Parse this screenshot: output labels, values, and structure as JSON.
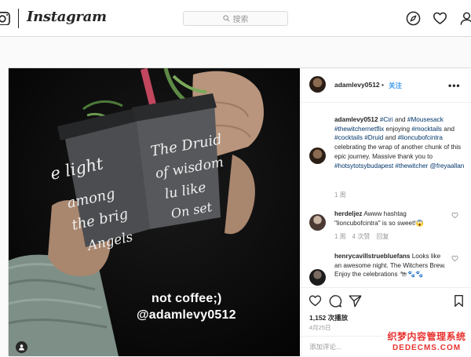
{
  "app": {
    "wordmark": "Instagram"
  },
  "search": {
    "placeholder": "搜索"
  },
  "media": {
    "overlay_line1": "not coffee;)",
    "overlay_line2": "@adamlevy0512",
    "cup_left_text": [
      "e light",
      "among",
      "the brig",
      "Angels"
    ],
    "cup_right_text": [
      "The Druid",
      "of wisdom",
      "lu like",
      "On set"
    ]
  },
  "post": {
    "username": "adamlevy0512",
    "dot": "•",
    "follow_label": "关注",
    "more_label": "•••",
    "caption_user": "adamlevy0512",
    "caption_parts": [
      {
        "t": " ",
        "tag": false
      },
      {
        "t": "#Ciri",
        "tag": true
      },
      {
        "t": " and ",
        "tag": false
      },
      {
        "t": "#Mousesack",
        "tag": true
      },
      {
        "t": " ",
        "tag": false
      },
      {
        "t": "#thewitchernetflix",
        "tag": true
      },
      {
        "t": " enjoying ",
        "tag": false
      },
      {
        "t": "#mocktails",
        "tag": true
      },
      {
        "t": " and ",
        "tag": false
      },
      {
        "t": "#cocktails",
        "tag": true
      },
      {
        "t": " ",
        "tag": false
      },
      {
        "t": "#Druid",
        "tag": true
      },
      {
        "t": " and ",
        "tag": false
      },
      {
        "t": "#lioncubofcintra",
        "tag": true
      },
      {
        "t": " celebrating the wrap of another chunk of this epic journey. Massive thank you to ",
        "tag": false
      },
      {
        "t": "#hotsytotsybudapest",
        "tag": true
      },
      {
        "t": " ",
        "tag": false
      },
      {
        "t": "#thewitcher",
        "tag": true
      },
      {
        "t": " ",
        "tag": false
      },
      {
        "t": "@freyaallan",
        "tag": true
      }
    ],
    "caption_time": "1 周",
    "comments": [
      {
        "user": "herdeljez",
        "text": " Awww hashtag \"lioncubofcintra\" is so sweet!😱",
        "time": "1 周",
        "likes": "4 次赞",
        "reply": "回复"
      },
      {
        "user": "henrycavillstruebluefans",
        "text": " Looks like an awesome night. The Witchers Brew. Enjoy the celebrations 🐄🐾🐾"
      }
    ],
    "likes": "1,152 次播放",
    "date": "4月25日",
    "add_comment_placeholder": "添加评论..."
  },
  "watermark": {
    "line1": "织梦内容管理系统",
    "line2": "DEDECMS.COM"
  },
  "colors": {
    "link": "#3897f0",
    "hashtag": "#003569",
    "muted": "#999999",
    "border": "#dbdbdb",
    "watermark": "#e8332f"
  }
}
